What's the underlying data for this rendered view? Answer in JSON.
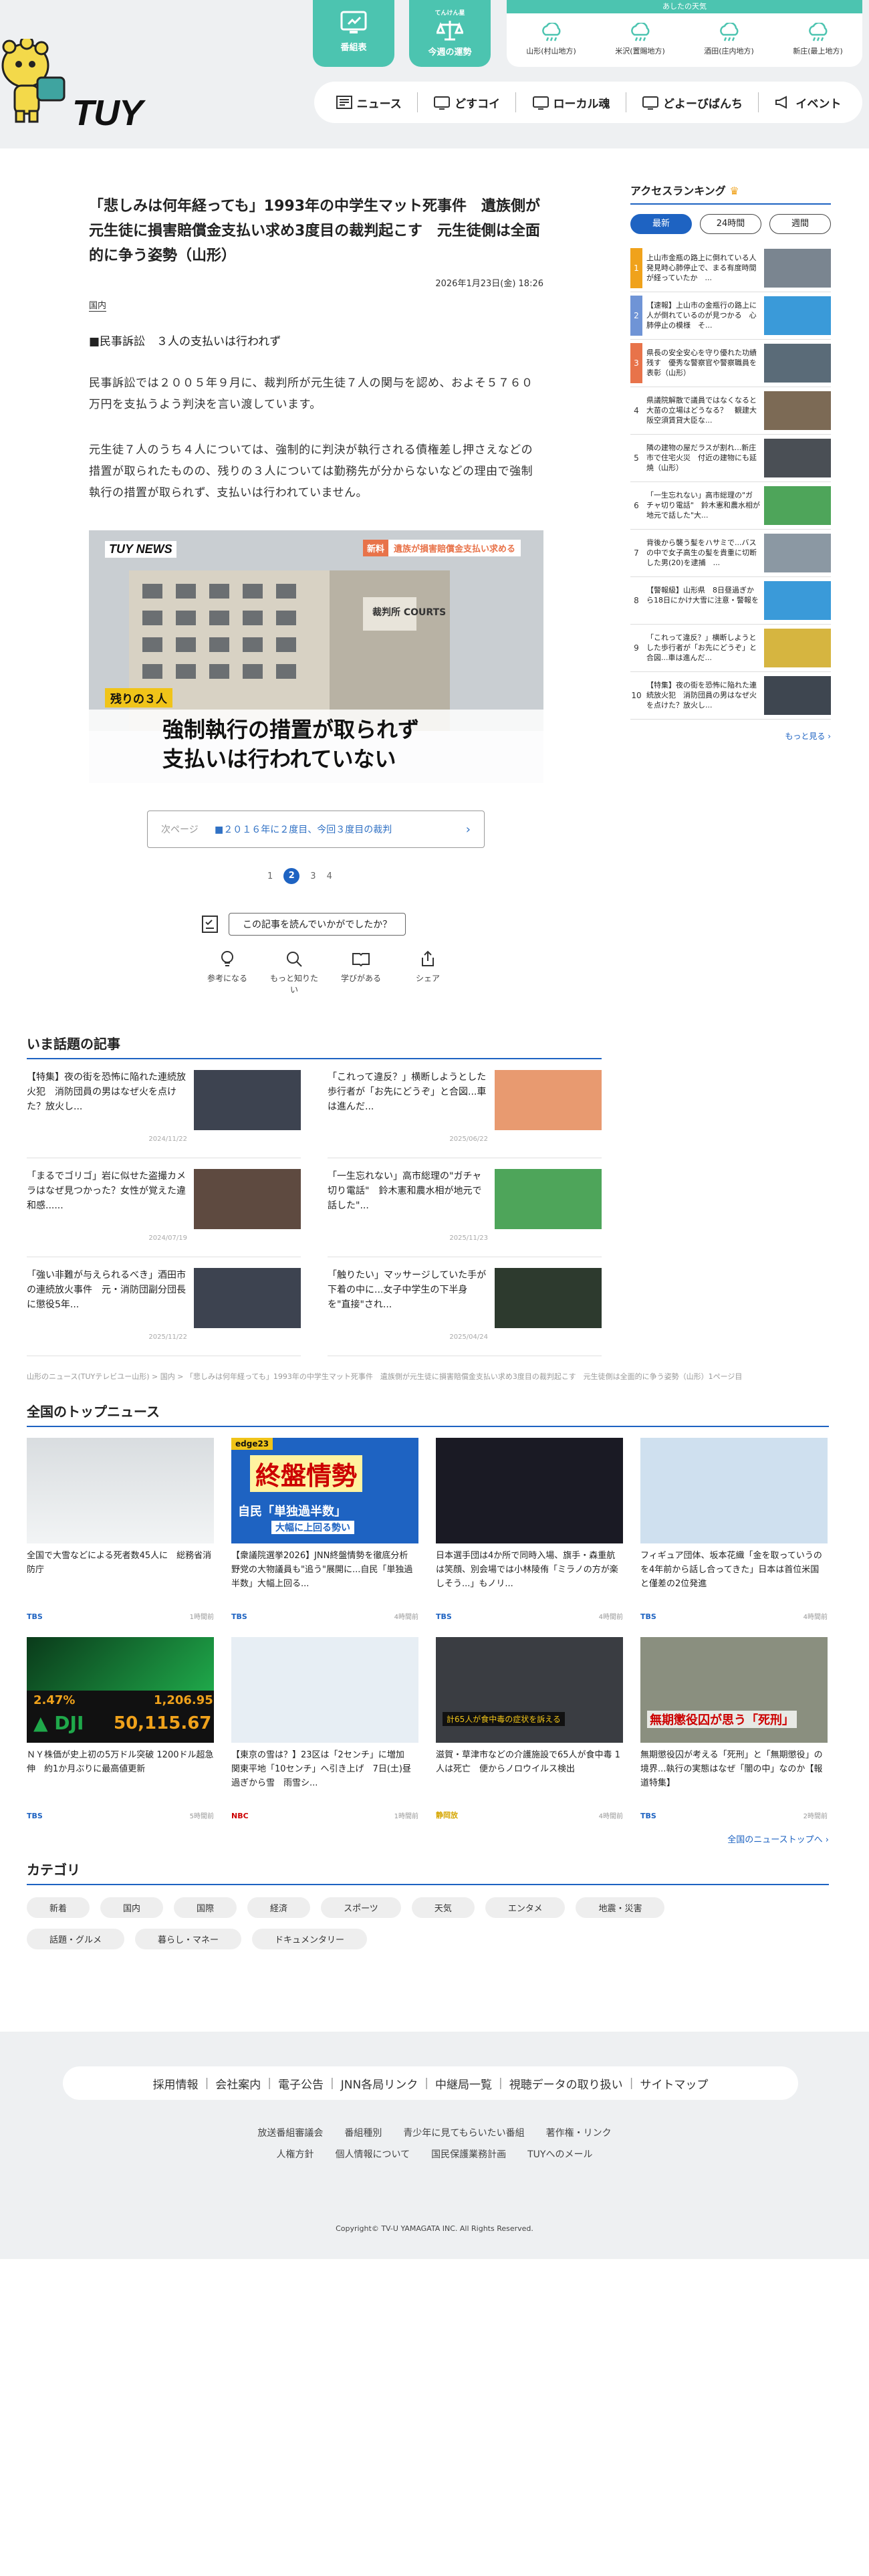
{
  "header": {
    "logo_text": "TUY",
    "top_buttons": [
      {
        "label": "番組表"
      },
      {
        "small": "てんけん星",
        "label": "今週の運勢"
      }
    ],
    "weather": {
      "title": "あしたの天気",
      "items": [
        "山形(村山地方)",
        "米沢(置賜地方)",
        "酒田(庄内地方)",
        "新庄(最上地方)"
      ]
    },
    "nav": [
      "ニュース",
      "どすコイ",
      "ローカル魂",
      "どよーびばんち",
      "イベント"
    ]
  },
  "article": {
    "title": "「悲しみは何年経っても」1993年の中学生マット死事件　遺族側が元生徒に損害賠償金支払い求め3度目の裁判起こす　元生徒側は全面的に争う姿勢（山形）",
    "date": "2026年1月23日(金) 18:26",
    "category": "国内",
    "lead": "■民事訴訟　３人の支払いは行われず",
    "p1": "民事訴訟では２００５年９月に、裁判所が元生徒７人の関与を認め、およそ５７６０万円を支払うよう判決を言い渡しています。",
    "p2": "元生徒７人のうち４人については、強制的に判決が執行される債権差し押さえなどの措置が取られたものの、残りの３人については勤務先が分からないなどの理由で強制執行の措置が取られず、支払いは行われていません。",
    "image": {
      "logo": "TUY NEWS",
      "banner_tag": "新料",
      "banner": "遺族が損害賠償金支払い求める",
      "sign": "裁判所 COURTS",
      "sub_tag": "残りの３人",
      "caption1": "強制執行の措置が取られず",
      "caption2": "支払いは行われていない"
    },
    "next_label": "次ページ",
    "next_title": "■２０１６年に２度目、今回３度目の裁判",
    "pages": [
      "1",
      "2",
      "3",
      "4"
    ],
    "feedback_q": "この記事を読んでいかがでしたか？",
    "reactions": [
      "参考になる",
      "もっと知りたい",
      "学びがある",
      "シェア"
    ]
  },
  "ranking": {
    "title": "アクセスランキング",
    "tabs": [
      "最新",
      "24時間",
      "週間"
    ],
    "items": [
      {
        "n": "1",
        "t": "上山市金瓶の路上に倒れている人　発見時心肺停止で、まる有度時間が経っていたか　..."
      },
      {
        "n": "2",
        "t": "【速報】上山市の金瓶行の路上に人が倒れているのが見つかる　心肺停止の模様　そ..."
      },
      {
        "n": "3",
        "t": "県長の安全安心を守り優れた功績残す　優秀な警察官や警察職員を表彰（山形）"
      },
      {
        "n": "4",
        "t": "県議院解散で議員ではなくなると大苗の立場はどうなる？　観建大阪空須賃貸大臣な..."
      },
      {
        "n": "5",
        "t": "隣の建物の屋だラスが割れ...新庄市で住宅火災　付近の建物にも延焼（山形）"
      },
      {
        "n": "6",
        "t": "「一生忘れない」高市総理の\"ガチャ切り電話\"　鈴木憲和農水相が地元で話した\"大..."
      },
      {
        "n": "7",
        "t": "背後から襲う髪をハサミで...バスの中で女子高生の髪を貴重に切断した男(20)を逮捕　..."
      },
      {
        "n": "8",
        "t": "【警報級】山形県　8日昼過ぎから18日にかけ大雪に注意・警報を"
      },
      {
        "n": "9",
        "t": "「これって違反？」横断しようとした歩行者が「お先にどうぞ」と合図...車は進んだ..."
      },
      {
        "n": "10",
        "t": "【特集】夜の街を恐怖に陥れた連続放火犯　消防団員の男はなぜ火を点けた？放火し..."
      }
    ],
    "more": "もっと見る"
  },
  "hot": {
    "title": "いま話題の記事",
    "items": [
      {
        "t": "【特集】夜の街を恐怖に陥れた連続放火犯　消防団員の男はなぜ火を点けた？放火し...",
        "d": "2024/11/22"
      },
      {
        "t": "「これって違反？」横断しようとした歩行者が「お先にどうぞ」と合図...車は進んだ...",
        "d": "2025/06/22"
      },
      {
        "t": "「まるでゴリゴ」岩に似せた盗撮カメラはなぜ見つかった？女性が覚えた違和感......",
        "d": "2024/07/19"
      },
      {
        "t": "「一生忘れない」高市総理の\"ガチャ切り電話\"　鈴木憲和農水相が地元で話した\"...",
        "d": "2025/11/23"
      },
      {
        "t": "「強い非難が与えられるべき」酒田市の連続放火事件　元・消防団副分団長に懲役5年...",
        "d": "2025/11/22"
      },
      {
        "t": "「触りたい」マッサージしていた手が下着の中に...女子中学生の下半身を\"直接\"され...",
        "d": "2025/04/24"
      }
    ]
  },
  "breadcrumb": "山形のニュース(TUYテレビユー山形) > 国内 > 「悲しみは何年経っても」1993年の中学生マット死事件　遺族側が元生徒に損害賠償金支払い求め3度目の裁判起こす　元生徒側は全面的に争う姿勢（山形）1ページ目",
  "national": {
    "title": "全国のトップニュース",
    "items": [
      {
        "t": "全国で大雪などによる死者数45人に　総務省消防庁",
        "src": "TBS",
        "tm": "1時間前",
        "th": "snow"
      },
      {
        "t": "【衆議院選挙2026】JNN終盤情勢を徹底分析　野党の大物議員も\"追う\"展開に...自民「単独過半数」大幅上回る...",
        "src": "TBS",
        "tm": "4時間前",
        "th": "election"
      },
      {
        "t": "日本選手団は4か所で同時入場、旗手・森重航は笑顔、別会場では小林陵侑「ミラノの方が楽しそう...」もノリ...",
        "src": "TBS",
        "tm": "4時間前",
        "th": "olympic"
      },
      {
        "t": "フィギュア団体、坂本花織「金を取っていうのを4年前から話し合ってきた」日本は首位米国と僅差の2位発進",
        "src": "TBS",
        "tm": "4時間前",
        "th": "figure"
      },
      {
        "t": "ＮＹ株価が史上初の5万ドル突破 1200ドル超急伸　約1か月ぶりに最高値更新",
        "src": "TBS",
        "tm": "5時間前",
        "th": "stock"
      },
      {
        "t": "【東京の雪は？】23区は「2センチ」に増加　関東平地「10センチ」へ引き上げ　7日(土)昼過ぎから雪　雨雪シ...",
        "src": "NBC",
        "tm": "1時間前",
        "th": "map"
      },
      {
        "t": "滋賀・草津市などの介護施設で65人が食中毒 1人は死亡　便からノロウイルス検出",
        "src": "静岡放",
        "tm": "4時間前",
        "th": "facility"
      },
      {
        "t": "無期懲役囚が考える「死刑」と「無期懲役」の境界...執行の実態はなぜ「闇の中」なのか【報道特集】",
        "src": "TBS",
        "tm": "2時間前",
        "th": "prison"
      }
    ],
    "stock": {
      "ratio": "2.47%",
      "idx": "DJI",
      "up": "1,206.95",
      "price": "50,115.67"
    },
    "election_banner": "終盤情勢",
    "election_tag": "edge23",
    "election_sub": "自民「単独過半数」",
    "election_sub2": "大幅に上回る勢い",
    "prison_cap": "無期懲役囚が思う「死刑」",
    "facility_cap": "計65人が食中毒の症状を訴える",
    "more": "全国のニューストップへ"
  },
  "categories": {
    "title": "カテゴリ",
    "items": [
      "新着",
      "国内",
      "国際",
      "経済",
      "スポーツ",
      "天気",
      "エンタメ",
      "地震・災害",
      "話題・グルメ",
      "暮らし・マネー",
      "ドキュメンタリー"
    ]
  },
  "footer": {
    "bar": [
      "採用情報",
      "会社案内",
      "電子公告",
      "JNN各局リンク",
      "中継局一覧",
      "視聴データの取り扱い",
      "サイトマップ"
    ],
    "links1": [
      "放送番組審議会",
      "番組種別",
      "青少年に見てもらいたい番組",
      "著作権・リンク"
    ],
    "links2": [
      "人権方針",
      "個人情報について",
      "国民保護業務計画",
      "TUYへのメール"
    ],
    "copyright": "Copyright© TV-U YAMAGATA INC. All Rights Reserved."
  },
  "colors": {
    "accent": "#1e63c2",
    "teal": "#4cc4b0",
    "rank1": "#f0a21b",
    "rank2": "#6f94d6",
    "rank3": "#e8734a"
  }
}
